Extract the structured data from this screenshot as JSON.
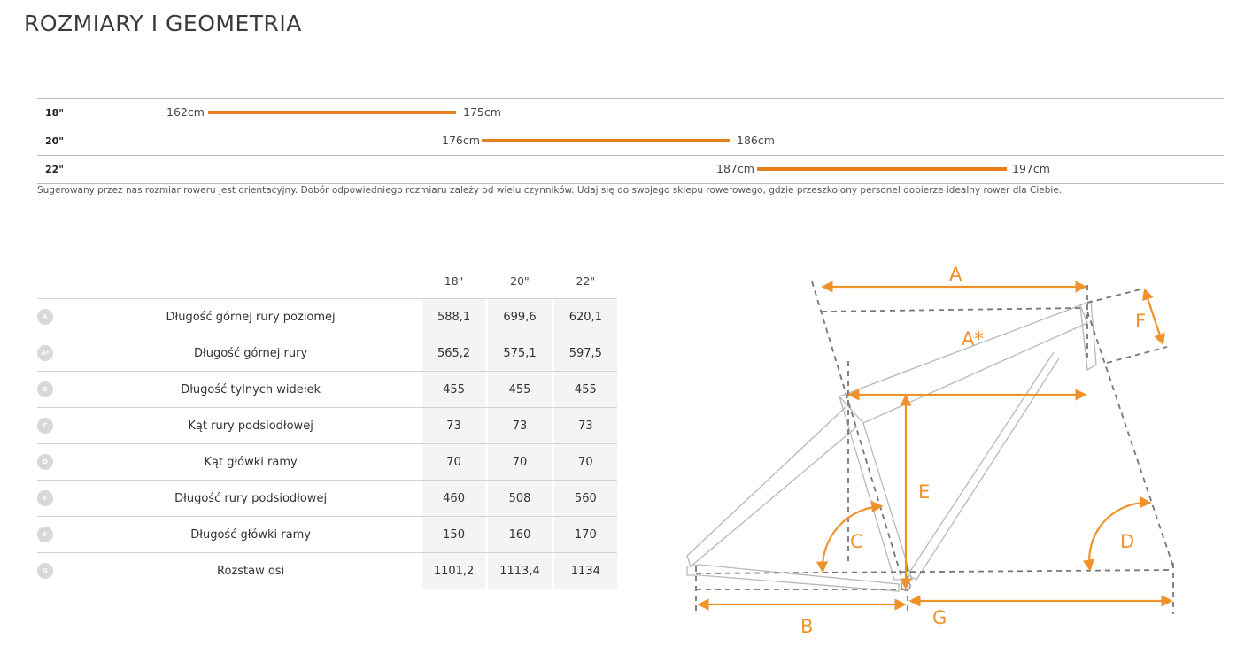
{
  "page": {
    "title": "ROZMIARY I GEOMETRIA"
  },
  "size_chart": {
    "rows": [
      {
        "size": "18\"",
        "min": "162cm",
        "max": "175cm"
      },
      {
        "size": "20\"",
        "min": "176cm",
        "max": "186cm"
      },
      {
        "size": "22\"",
        "min": "187cm",
        "max": "197cm"
      }
    ],
    "bar_color": "#e87f1f",
    "disclaimer": "Sugerowany przez nas rozmiar roweru jest orientacyjny. Dobór odpowiedniego rozmiaru zależy od wielu czynników. Udaj się do swojego sklepu rowerowego, gdzie przeszkolony personel dobierze idealny rower dla Ciebie."
  },
  "geometry": {
    "sizes": [
      "18\"",
      "20\"",
      "22\""
    ],
    "rows": [
      {
        "code": "A",
        "label": "Długość górnej rury poziomej",
        "values": [
          "588,1",
          "699,6",
          "620,1"
        ]
      },
      {
        "code": "A*",
        "label": "Długość górnej rury",
        "values": [
          "565,2",
          "575,1",
          "597,5"
        ]
      },
      {
        "code": "B",
        "label": "Długość tylnych widełek",
        "values": [
          "455",
          "455",
          "455"
        ]
      },
      {
        "code": "C",
        "label": "Kąt rury podsiodłowej",
        "values": [
          "73",
          "73",
          "73"
        ]
      },
      {
        "code": "D",
        "label": "Kąt główki ramy",
        "values": [
          "70",
          "70",
          "70"
        ]
      },
      {
        "code": "E",
        "label": "Długość rury podsiodłowej",
        "values": [
          "460",
          "508",
          "560"
        ]
      },
      {
        "code": "F",
        "label": "Długość główki ramy",
        "values": [
          "150",
          "160",
          "170"
        ]
      },
      {
        "code": "G",
        "label": "Rozstaw osi",
        "values": [
          "1101,2",
          "1113,4",
          "1134"
        ]
      }
    ]
  },
  "diagram": {
    "labels": {
      "a": "A",
      "a_star": "A*",
      "b": "B",
      "c": "C",
      "d": "D",
      "e": "E",
      "f": "F",
      "g": "G"
    },
    "accent_color": "#f0922a"
  }
}
